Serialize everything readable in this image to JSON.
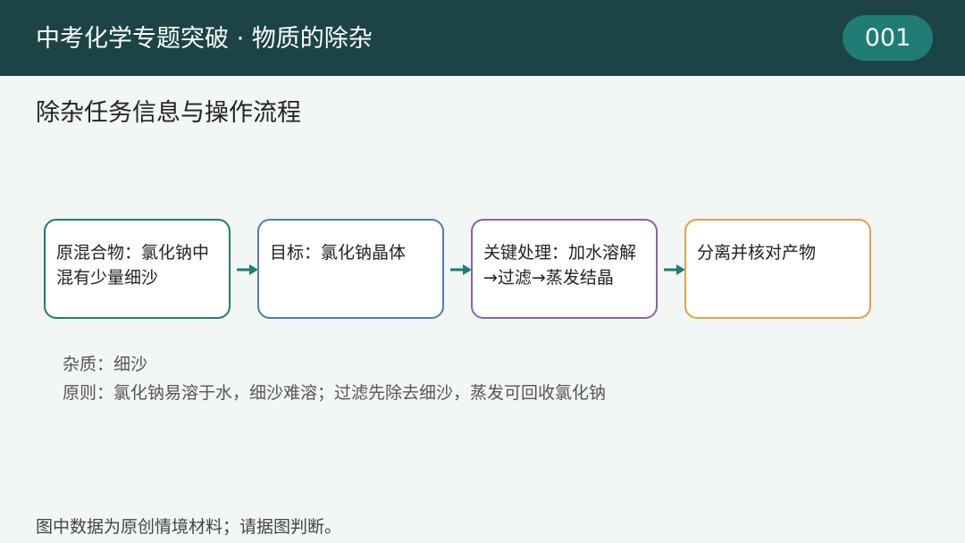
{
  "header": {
    "title": "中考化学专题突破 · 物质的除杂",
    "page_number": "001"
  },
  "section_title": "除杂任务信息与操作流程",
  "steps": [
    {
      "text": "原混合物：氯化钠中混有少量细沙",
      "color": "#1f7d75"
    },
    {
      "text": "目标：氯化钠晶体",
      "color": "#4f80b0"
    },
    {
      "text": "关键处理：加水溶解→过滤→蒸发结晶",
      "color": "#8a63a9"
    },
    {
      "text": "分离并核对产物",
      "color": "#e0a24a"
    }
  ],
  "arrow_color": "#1f7d75",
  "notes": [
    "杂质：细沙",
    "原则：氯化钠易溶于水，细沙难溶；过滤先除去细沙，蒸发可回收氯化钠"
  ],
  "footer_note": "图中数据为原创情境材料；请据图判断。",
  "colors": {
    "header_bg": "#1c4446",
    "badge_bg": "#1f7d75",
    "page_bg": "#f2f6f5"
  }
}
